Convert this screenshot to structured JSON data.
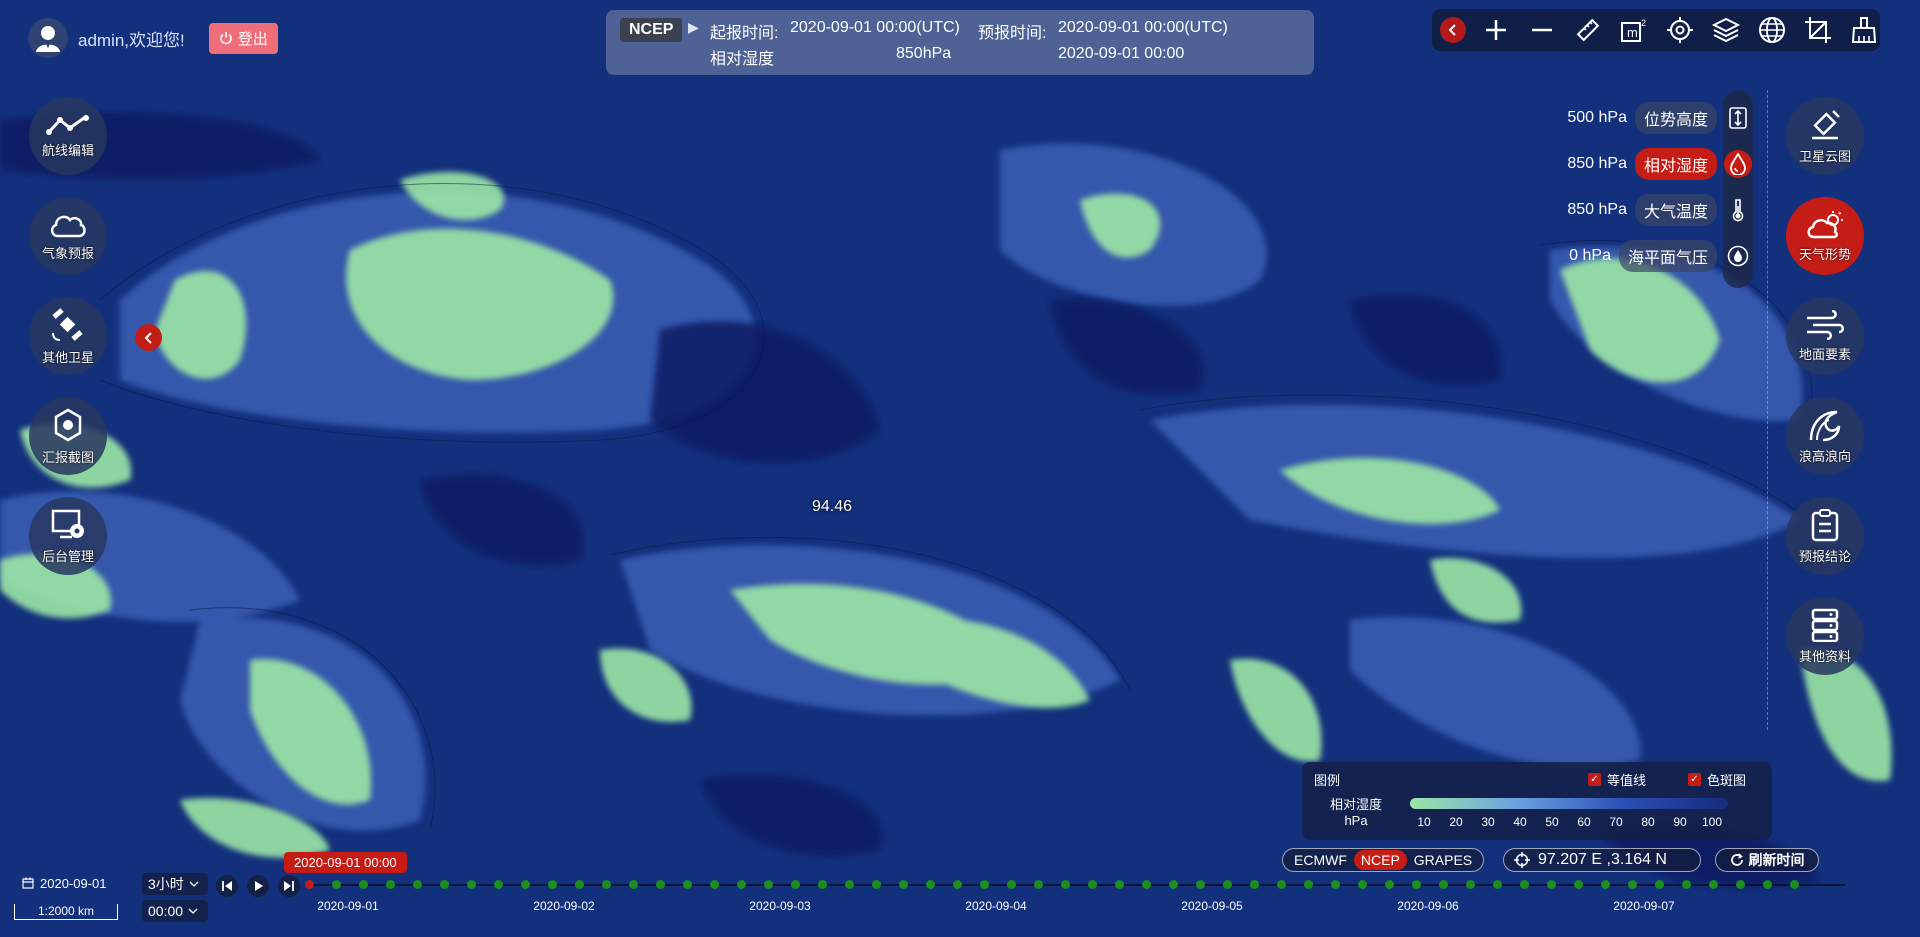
{
  "user": {
    "welcome_text": "admin,欢迎您!",
    "logout_label": "登出"
  },
  "info_panel": {
    "model": "NCEP",
    "start_label": "起报时间:",
    "start_value": "2020-09-01 00:00(UTC)",
    "forecast_label": "预报时间:",
    "forecast_value": "2020-09-01 00:00(UTC)",
    "variable": "相对湿度",
    "level": "850hPa",
    "valid_time": "2020-09-01 00:00"
  },
  "toolbar": {
    "icons": [
      "collapse-icon",
      "zoom-in-icon",
      "zoom-out-icon",
      "ruler-icon",
      "area-measure-icon",
      "locate-icon",
      "layers-icon",
      "globe-icon",
      "crop-icon",
      "clear-icon"
    ]
  },
  "left_nav": [
    {
      "label": "航线编辑",
      "icon": "route-icon"
    },
    {
      "label": "气象预报",
      "icon": "cloud-icon"
    },
    {
      "label": "其他卫星",
      "icon": "satellite-icon"
    },
    {
      "label": "汇报截图",
      "icon": "camera-icon"
    },
    {
      "label": "后台管理",
      "icon": "admin-icon"
    }
  ],
  "right_nav": [
    {
      "label": "卫星云图",
      "icon": "satellite-cloud-icon"
    },
    {
      "label": "天气形势",
      "icon": "weather-icon"
    },
    {
      "label": "地面要素",
      "icon": "wind-icon"
    },
    {
      "label": "浪高浪向",
      "icon": "wave-icon"
    },
    {
      "label": "预报结论",
      "icon": "clipboard-icon"
    },
    {
      "label": "其他资料",
      "icon": "database-icon"
    }
  ],
  "layers": [
    {
      "level": "500 hPa",
      "name": "位势高度",
      "icon": "height-icon",
      "active": false
    },
    {
      "level": "850 hPa",
      "name": "相对湿度",
      "icon": "humidity-icon",
      "active": true
    },
    {
      "level": "850 hPa",
      "name": "大气温度",
      "icon": "thermometer-icon",
      "active": false
    },
    {
      "level": "0 hPa",
      "name": "海平面气压",
      "icon": "pressure-icon",
      "active": false
    }
  ],
  "map": {
    "probe_value": "94.46",
    "colors": {
      "humid": "#9be6a6",
      "mid": "#5f87d6",
      "dry": "#172b7b"
    }
  },
  "legend": {
    "title": "图例",
    "contour_label": "等值线",
    "color_label": "色斑图",
    "variable": "相对湿度",
    "unit": "hPa",
    "ticks": [
      "10",
      "20",
      "30",
      "40",
      "50",
      "60",
      "70",
      "80",
      "90",
      "100"
    ]
  },
  "models": {
    "options": [
      "ECMWF",
      "NCEP",
      "GRAPES"
    ],
    "selected": "NCEP"
  },
  "coords": "97.207 E ,3.164 N",
  "refresh_label": "刷新时间",
  "bottom": {
    "date": "2020-09-01",
    "scale": "1:2000 km",
    "step": "3小时",
    "hour": "00:00"
  },
  "timeline": {
    "current_label": "2020-09-01 00:00",
    "days": [
      "2020-09-01",
      "2020-09-02",
      "2020-09-03",
      "2020-09-04",
      "2020-09-05",
      "2020-09-06",
      "2020-09-07"
    ]
  }
}
